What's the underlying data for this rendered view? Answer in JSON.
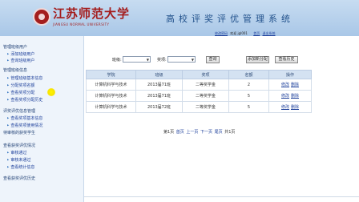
{
  "header": {
    "logo_cn": "江苏师范大学",
    "logo_en": "JIANGSU NORMAL UNIVERSITY",
    "system_title": "高校评奖评优管理系统",
    "change_password": "修改密码",
    "welcome": "欢迎 jgl001",
    "home": "首页",
    "logout": "退出系统"
  },
  "sidebar": {
    "lines": [
      {
        "text": "管理班级用户"
      },
      {
        "text": "添加班级用户"
      },
      {
        "text": "查询班级用户"
      },
      {
        "text": "管理班级信息"
      },
      {
        "text": "管理班级基本信息"
      },
      {
        "text": "分配奖项名额"
      },
      {
        "text": "查看奖项分配"
      },
      {
        "text": "查看奖项分配历史"
      },
      {
        "text": "评奖评优信息管理"
      },
      {
        "text": "查看奖项基本信息"
      },
      {
        "text": "查看奖项使用情况"
      },
      {
        "text": "待审核的获奖学生"
      },
      {
        "text": "查看获奖评优情况"
      },
      {
        "text": "审核通过"
      },
      {
        "text": "审核未通过"
      },
      {
        "text": "查看统计信息"
      },
      {
        "text": "查看获奖评优历史"
      }
    ]
  },
  "filter": {
    "class_label": "班级:",
    "award_label": "奖项:",
    "query_button": "查询",
    "add_quota_button": "添加新分配",
    "history_button": "查看历史"
  },
  "table": {
    "columns": [
      "学院",
      "班级",
      "奖项",
      "名额",
      "操作"
    ],
    "rows": [
      {
        "college": "计算机科学与技术",
        "class": "2013届71班",
        "award": "二等奖学金",
        "quota": "2",
        "edit": "修改",
        "delete": "删除"
      },
      {
        "college": "计算机科学与技术",
        "class": "2013届71班",
        "award": "二等奖学金",
        "quota": "5",
        "edit": "修改",
        "delete": "删除"
      },
      {
        "college": "计算机科学与技术",
        "class": "2013届72班",
        "award": "二等奖学金",
        "quota": "5",
        "edit": "修改",
        "delete": "删除"
      }
    ]
  },
  "pager": {
    "current": "第1页",
    "first": "首页",
    "prev": "上一页",
    "next": "下一页",
    "last": "尾页",
    "total": "共1页"
  }
}
